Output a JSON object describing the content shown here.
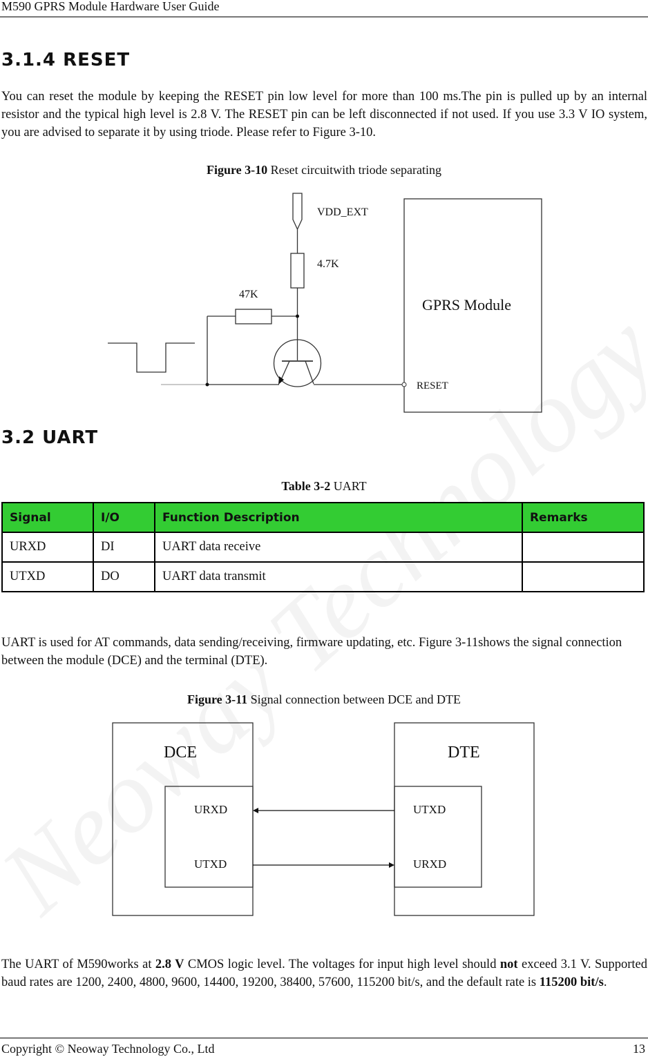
{
  "header": {
    "title": "M590 GPRS Module Hardware User Guide"
  },
  "watermark": {
    "text": "Neoway Technology",
    "color": "#f2f2f2"
  },
  "section_reset": {
    "heading": "3.1.4 RESET",
    "paragraph": "You can reset the module by keeping the RESET pin low level for more than 100 ms.The pin is pulled up by an internal resistor and the typical high level is 2.8 V. The RESET pin can be left disconnected if not used. If you use 3.3 V IO system, you are advised to separate it by using triode. Please refer to Figure 3-10.",
    "figure_caption_label": "Figure 3-10",
    "figure_caption_text": " Reset circuitwith triode separating",
    "figure": {
      "supply_label": "VDD_EXT",
      "pullup_resistor_label": "4.7K",
      "base_resistor_label": "47K",
      "module_label": "GPRS Module",
      "pin_label": "RESET"
    }
  },
  "section_uart": {
    "heading": "3.2 UART",
    "table_caption_label": "Table 3-2",
    "table_caption_text": " UART",
    "table": {
      "header_color": "#33cc33",
      "columns": [
        "Signal",
        "I/O",
        "Function Description",
        "Remarks"
      ],
      "rows": [
        [
          "URXD",
          "DI",
          "UART data receive",
          ""
        ],
        [
          "UTXD",
          "DO",
          "UART data transmit",
          ""
        ]
      ]
    },
    "paragraph1": "UART is used for AT commands, data sending/receiving, firmware updating, etc. Figure 3-11shows the signal connection between the module (DCE) and the terminal (DTE).",
    "figure_caption_label": "Figure 3-11",
    "figure_caption_text": " Signal connection between DCE and DTE",
    "figure": {
      "dce_label": "DCE",
      "dte_label": "DTE",
      "dce_pins": [
        "URXD",
        "UTXD"
      ],
      "dte_pins": [
        "UTXD",
        "URXD"
      ]
    },
    "paragraph2": {
      "p1": "The UART of M590works at ",
      "b1": "2.8 V",
      "p2": " CMOS logic level. The voltages for input high level should ",
      "b2": "not",
      "p3": " exceed 3.1 V. Supported baud rates are 1200, 2400, 4800, 9600, 14400, 19200, 38400, 57600, 115200 bit/s, and the default rate is ",
      "b3": "115200 bit/s",
      "p4": "."
    }
  },
  "footer": {
    "copyright": "Copyright © Neoway Technology Co., Ltd",
    "page_number": "13"
  }
}
